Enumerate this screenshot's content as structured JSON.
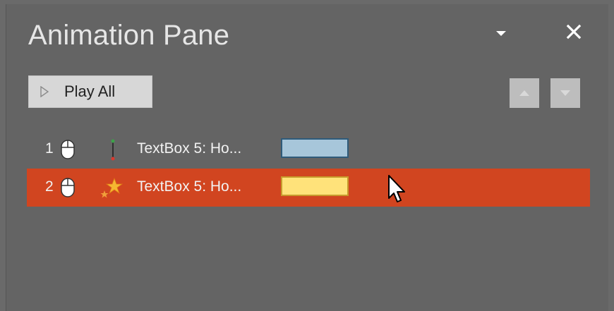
{
  "pane": {
    "title": "Animation Pane",
    "menu_icon": "caret-down-icon",
    "close_icon": "close-icon"
  },
  "toolbar": {
    "play_all_label": "Play All",
    "play_icon": "play-outline-icon",
    "move_up_icon": "arrow-up-icon",
    "move_down_icon": "arrow-down-icon"
  },
  "animations": [
    {
      "index": "1",
      "trigger_icon": "mouse-click-icon",
      "effect_icon": "motion-path-icon",
      "name": "TextBox 5: Ho...",
      "timing_color": "#a7c6da",
      "timing_border": "#2f5b7a",
      "selected": false
    },
    {
      "index": "2",
      "trigger_icon": "mouse-click-icon",
      "effect_icon": "emphasis-star-icon",
      "name": "TextBox 5: Ho...",
      "timing_color": "#ffe27a",
      "timing_border": "#c79a2c",
      "selected": true
    }
  ],
  "colors": {
    "pane_bg": "#646464",
    "selection": "#d14520",
    "button_bg": "#d7d7d7"
  }
}
